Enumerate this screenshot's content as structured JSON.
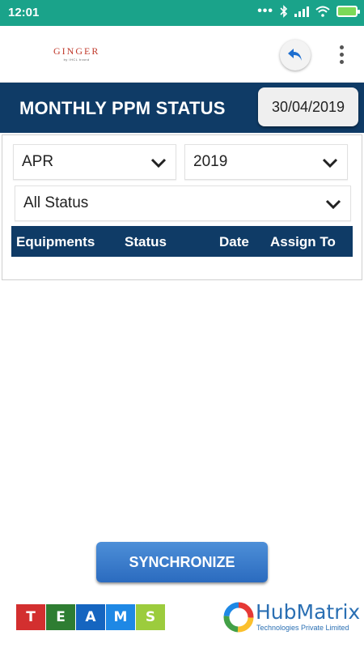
{
  "status_bar": {
    "time": "12:01",
    "icons": [
      "more-dots-icon",
      "bluetooth-icon",
      "signal-icon",
      "wifi-icon",
      "battery-charging-icon"
    ]
  },
  "app_bar": {
    "logo_text": "GINGER",
    "logo_subtext": "by IHCL brand"
  },
  "title_bar": {
    "title": "MONTHLY PPM STATUS",
    "date": "30/04/2019"
  },
  "filters": {
    "month": "APR",
    "year": "2019",
    "status": "All Status"
  },
  "table": {
    "columns": [
      "Equipments",
      "Status",
      "Date",
      "Assign To"
    ]
  },
  "actions": {
    "synchronize_label": "SYNCHRONIZE"
  },
  "footer": {
    "teams_letters": [
      "T",
      "E",
      "A",
      "M",
      "S"
    ],
    "teams_colors": [
      "#d32f2f",
      "#2e7d32",
      "#1565c0",
      "#1e88e5",
      "#9ccc3d"
    ],
    "company_name": "HubMatrix",
    "company_tagline": "Technologies Private Limited"
  },
  "colors": {
    "status_bar": "#1aa38a",
    "header_navy": "#0f3b66",
    "button_blue": "#2b6bbf"
  }
}
